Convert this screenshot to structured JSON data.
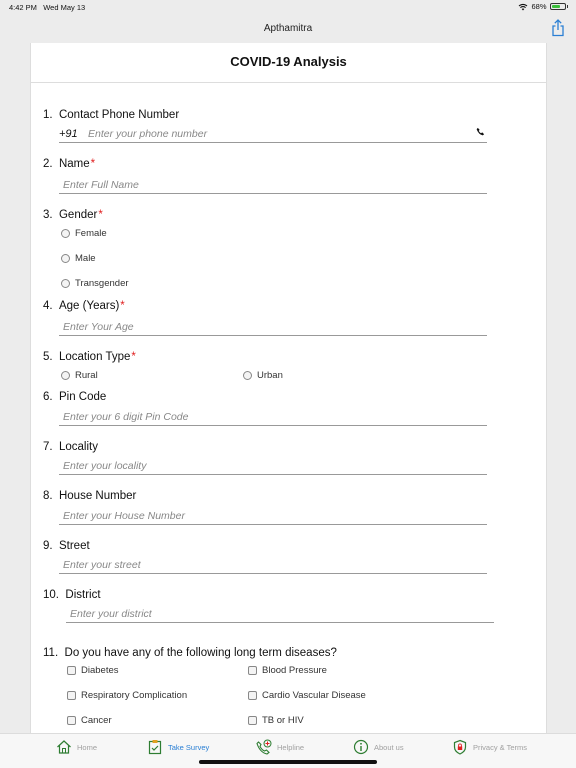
{
  "status_bar": {
    "time": "4:42 PM",
    "date": "Wed May 13",
    "battery": "68%",
    "battery_level": 0.68
  },
  "app": {
    "title": "Apthamitra"
  },
  "form": {
    "title": "COVID-19 Analysis",
    "q1": {
      "num": "1.",
      "label": "Contact Phone Number",
      "prefix": "+91",
      "placeholder": "Enter your phone number"
    },
    "q2": {
      "num": "2.",
      "label": "Name",
      "required": "*",
      "placeholder": "Enter Full Name"
    },
    "q3": {
      "num": "3.",
      "label": "Gender",
      "required": "*",
      "options": [
        "Female",
        "Male",
        "Transgender"
      ]
    },
    "q4": {
      "num": "4.",
      "label": "Age (Years)",
      "required": "*",
      "placeholder": "Enter Your Age"
    },
    "q5": {
      "num": "5.",
      "label": "Location Type",
      "required": "*",
      "options": [
        "Rural",
        "Urban"
      ]
    },
    "q6": {
      "num": "6.",
      "label": "Pin Code",
      "placeholder": "Enter your 6 digit Pin Code"
    },
    "q7": {
      "num": "7.",
      "label": "Locality",
      "placeholder": "Enter your locality"
    },
    "q8": {
      "num": "8.",
      "label": "House Number",
      "placeholder": "Enter your House Number"
    },
    "q9": {
      "num": "9.",
      "label": "Street",
      "placeholder": "Enter your street"
    },
    "q10": {
      "num": "10.",
      "label": "District",
      "placeholder": "Enter your district"
    },
    "q11": {
      "num": "11.",
      "label": "Do you have any of the following long term diseases?",
      "options": [
        "Diabetes",
        "Blood Pressure",
        "Respiratory Complication",
        "Cardio Vascular Disease",
        "Cancer",
        "TB or HIV"
      ]
    }
  },
  "tabs": [
    {
      "label": "Home",
      "icon": "home-icon"
    },
    {
      "label": "Take Survey",
      "icon": "survey-icon",
      "active": true
    },
    {
      "label": "Helpline",
      "icon": "phone-icon"
    },
    {
      "label": "About us",
      "icon": "info-icon"
    },
    {
      "label": "Privacy & Terms",
      "icon": "shield-icon"
    }
  ],
  "colors": {
    "accent": "#2a7fd4",
    "required": "#e02020",
    "tab_icon": "#2e7d32"
  }
}
